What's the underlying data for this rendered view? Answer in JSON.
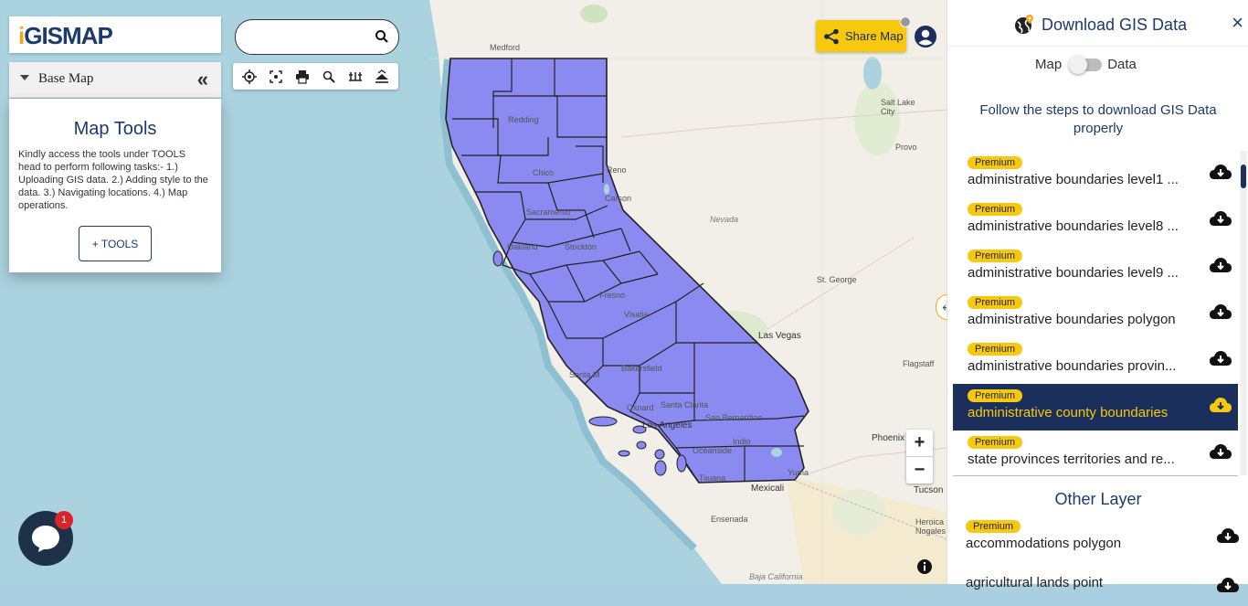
{
  "map": {
    "labels": {
      "medford": "Medford",
      "redding": "Redding",
      "chico": "Chico",
      "reno": "Reno",
      "carson": "Carson",
      "sacramento": "Sacramento",
      "oakland": "Oakland",
      "stockton": "Stockton",
      "fresno": "Fresno",
      "visalia": "Visalia",
      "bakersfield": "Bakersfield",
      "santa_maria": "Santa M",
      "oxnard": "Oxnard",
      "santa_clarita": "Santa Clarita",
      "los_angeles": "Los Angeles",
      "san_bernardino": "San Bernardino",
      "oceanside": "Oceanside",
      "indio": "Indio",
      "tijuana": "Tijuana",
      "yuma": "Yuma",
      "mexicali": "Mexicali",
      "ensenada": "Ensenada",
      "baja": "Baja California",
      "nevada": "Nevada",
      "las_vegas": "Las Vegas",
      "st_george": "St. George",
      "flagstaff": "Flagstaff",
      "phoenix": "Phoenix",
      "tucson": "Tucson",
      "heroica": "Heroica Nogales",
      "salt_lake": "Salt Lake City",
      "provo": "Provo"
    }
  },
  "logo": {
    "text_i": "i",
    "text_rest": "GISMAP"
  },
  "basemap": {
    "label": "Base Map",
    "collapse": "«"
  },
  "tools": {
    "title": "Map Tools",
    "description": "Kindly access the tools under TOOLS head to perform following tasks:- 1.) Uploading GIS data. 2.) Adding style to the data. 3.) Navigating locations. 4.) Map operations.",
    "button": "+ TOOLS"
  },
  "search": {
    "placeholder": "",
    "value": ""
  },
  "toolbar": {
    "icons": [
      "locate-icon",
      "fullscreen-icon",
      "print-icon",
      "zoom-search-icon",
      "measure-icon",
      "layers-icon"
    ]
  },
  "share": {
    "label": "Share Map"
  },
  "zoom": {
    "in": "+",
    "out": "−"
  },
  "chat": {
    "badge": "1"
  },
  "panel": {
    "title": "Download GIS Data",
    "close": "×",
    "toggle": {
      "left": "Map",
      "right": "Data"
    },
    "instructions": "Follow the steps to download GIS Data properly",
    "toggle_arrow": "↤",
    "items": [
      {
        "badge": "Premium",
        "name": "administrative boundaries level1 ...",
        "selected": false
      },
      {
        "badge": "Premium",
        "name": "administrative boundaries level8 ...",
        "selected": false
      },
      {
        "badge": "Premium",
        "name": "administrative boundaries level9 ...",
        "selected": false
      },
      {
        "badge": "Premium",
        "name": "administrative boundaries polygon",
        "selected": false
      },
      {
        "badge": "Premium",
        "name": "administrative boundaries provin...",
        "selected": false
      },
      {
        "badge": "Premium",
        "name": "administrative county boundaries",
        "selected": true
      },
      {
        "badge": "Premium",
        "name": "state provinces territories and re...",
        "selected": false
      }
    ],
    "other_head": "Other Layer",
    "other_items": [
      {
        "badge": "Premium",
        "name": "accommodations polygon"
      },
      {
        "badge": "",
        "name": "agricultural lands point"
      }
    ]
  },
  "colors": {
    "accent": "#f6c90e",
    "navy": "#1b2f5d",
    "water": "#aad3df",
    "land": "#f2efe9",
    "county_fill": "#8a8af0"
  }
}
